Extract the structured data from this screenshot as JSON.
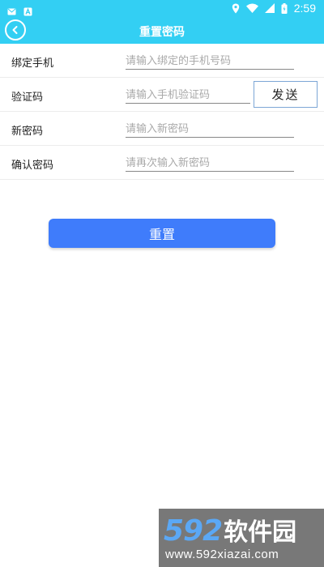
{
  "status_bar": {
    "time": "2:59",
    "left_icons": [
      "message-icon",
      "app-icon"
    ],
    "right_icons": [
      "location-icon",
      "wifi-icon",
      "signal-icon",
      "battery-icon"
    ]
  },
  "header": {
    "title": "重置密码",
    "back_icon": "back-circle-icon",
    "background": "#33cff3"
  },
  "form": {
    "phone": {
      "label": "绑定手机",
      "placeholder": "请输入绑定的手机号码",
      "value": ""
    },
    "code": {
      "label": "验证码",
      "placeholder": "请输入手机验证码",
      "value": "",
      "send_label": "发送"
    },
    "new_password": {
      "label": "新密码",
      "placeholder": "请输入新密码",
      "value": ""
    },
    "confirm_password": {
      "label": "确认密码",
      "placeholder": "请再次输入新密码",
      "value": ""
    }
  },
  "actions": {
    "reset_label": "重置",
    "reset_color": "#3f7cfb"
  },
  "watermark": {
    "logo_number": "592",
    "logo_text": "软件园",
    "url": "www.592xiazai.com"
  }
}
